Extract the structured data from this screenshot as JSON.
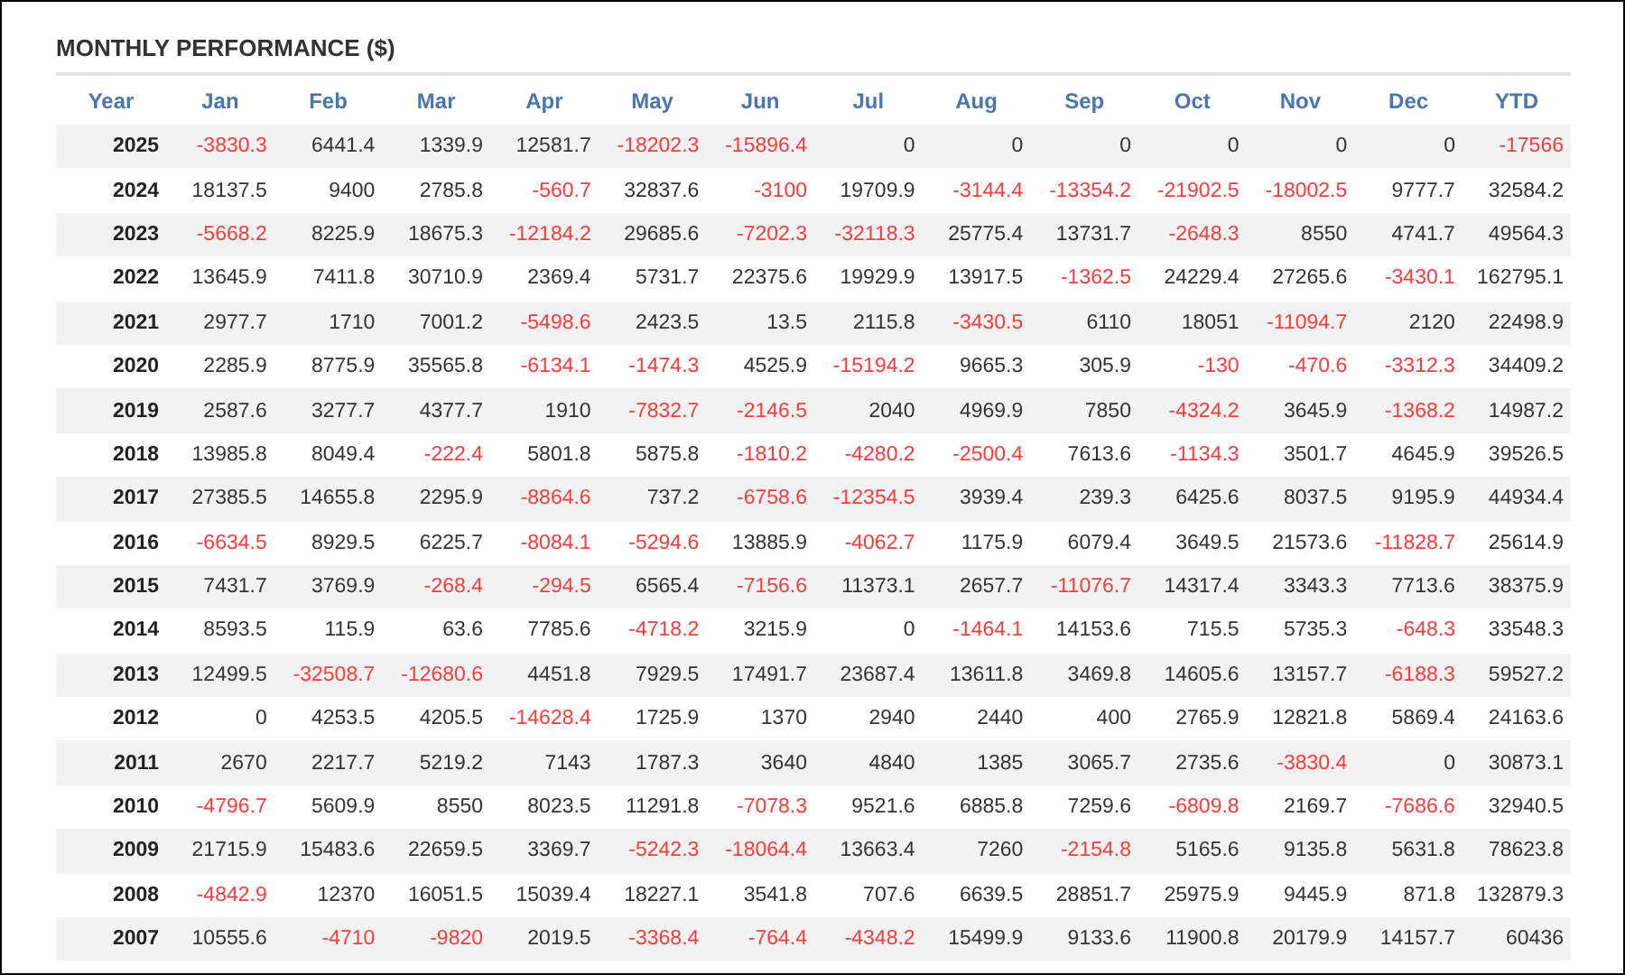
{
  "title": "MONTHLY PERFORMANCE ($)",
  "columns": [
    "Year",
    "Jan",
    "Feb",
    "Mar",
    "Apr",
    "May",
    "Jun",
    "Jul",
    "Aug",
    "Sep",
    "Oct",
    "Nov",
    "Dec",
    "YTD"
  ],
  "rows": [
    {
      "year": "2025",
      "cells": [
        {
          "text": "-3830.3",
          "loss": true
        },
        {
          "text": "6441.4",
          "loss": false
        },
        {
          "text": "1339.9",
          "loss": false
        },
        {
          "text": "12581.7",
          "loss": false
        },
        {
          "text": "-18202.3",
          "loss": true
        },
        {
          "text": "-15896.4",
          "loss": true
        },
        {
          "text": "0",
          "loss": false
        },
        {
          "text": "0",
          "loss": false
        },
        {
          "text": "0",
          "loss": false
        },
        {
          "text": "0",
          "loss": false
        },
        {
          "text": "0",
          "loss": false
        },
        {
          "text": "0",
          "loss": false
        },
        {
          "text": "-17566",
          "loss": true
        }
      ]
    },
    {
      "year": "2024",
      "cells": [
        {
          "text": "18137.5",
          "loss": false
        },
        {
          "text": "9400",
          "loss": false
        },
        {
          "text": "2785.8",
          "loss": false
        },
        {
          "text": "-560.7",
          "loss": true
        },
        {
          "text": "32837.6",
          "loss": false
        },
        {
          "text": "-3100",
          "loss": true
        },
        {
          "text": "19709.9",
          "loss": false
        },
        {
          "text": "-3144.4",
          "loss": true
        },
        {
          "text": "-13354.2",
          "loss": true
        },
        {
          "text": "-21902.5",
          "loss": true
        },
        {
          "text": "-18002.5",
          "loss": true
        },
        {
          "text": "9777.7",
          "loss": false
        },
        {
          "text": "32584.2",
          "loss": false
        }
      ]
    },
    {
      "year": "2023",
      "cells": [
        {
          "text": "-5668.2",
          "loss": true
        },
        {
          "text": "8225.9",
          "loss": false
        },
        {
          "text": "18675.3",
          "loss": false
        },
        {
          "text": "-12184.2",
          "loss": true
        },
        {
          "text": "29685.6",
          "loss": false
        },
        {
          "text": "-7202.3",
          "loss": true
        },
        {
          "text": "-32118.3",
          "loss": true
        },
        {
          "text": "25775.4",
          "loss": false
        },
        {
          "text": "13731.7",
          "loss": false
        },
        {
          "text": "-2648.3",
          "loss": true
        },
        {
          "text": "8550",
          "loss": false
        },
        {
          "text": "4741.7",
          "loss": false
        },
        {
          "text": "49564.3",
          "loss": false
        }
      ]
    },
    {
      "year": "2022",
      "cells": [
        {
          "text": "13645.9",
          "loss": false
        },
        {
          "text": "7411.8",
          "loss": false
        },
        {
          "text": "30710.9",
          "loss": false
        },
        {
          "text": "2369.4",
          "loss": false
        },
        {
          "text": "5731.7",
          "loss": false
        },
        {
          "text": "22375.6",
          "loss": false
        },
        {
          "text": "19929.9",
          "loss": false
        },
        {
          "text": "13917.5",
          "loss": false
        },
        {
          "text": "-1362.5",
          "loss": true
        },
        {
          "text": "24229.4",
          "loss": false
        },
        {
          "text": "27265.6",
          "loss": false
        },
        {
          "text": "-3430.1",
          "loss": true
        },
        {
          "text": "162795.1",
          "loss": false
        }
      ]
    },
    {
      "year": "2021",
      "cells": [
        {
          "text": "2977.7",
          "loss": false
        },
        {
          "text": "1710",
          "loss": false
        },
        {
          "text": "7001.2",
          "loss": false
        },
        {
          "text": "-5498.6",
          "loss": true
        },
        {
          "text": "2423.5",
          "loss": false
        },
        {
          "text": "13.5",
          "loss": false
        },
        {
          "text": "2115.8",
          "loss": false
        },
        {
          "text": "-3430.5",
          "loss": true
        },
        {
          "text": "6110",
          "loss": false
        },
        {
          "text": "18051",
          "loss": false
        },
        {
          "text": "-11094.7",
          "loss": true
        },
        {
          "text": "2120",
          "loss": false
        },
        {
          "text": "22498.9",
          "loss": false
        }
      ]
    },
    {
      "year": "2020",
      "cells": [
        {
          "text": "2285.9",
          "loss": false
        },
        {
          "text": "8775.9",
          "loss": false
        },
        {
          "text": "35565.8",
          "loss": false
        },
        {
          "text": "-6134.1",
          "loss": true
        },
        {
          "text": "-1474.3",
          "loss": true
        },
        {
          "text": "4525.9",
          "loss": false
        },
        {
          "text": "-15194.2",
          "loss": true
        },
        {
          "text": "9665.3",
          "loss": false
        },
        {
          "text": "305.9",
          "loss": false
        },
        {
          "text": "-130",
          "loss": true
        },
        {
          "text": "-470.6",
          "loss": true
        },
        {
          "text": "-3312.3",
          "loss": true
        },
        {
          "text": "34409.2",
          "loss": false
        }
      ]
    },
    {
      "year": "2019",
      "cells": [
        {
          "text": "2587.6",
          "loss": false
        },
        {
          "text": "3277.7",
          "loss": false
        },
        {
          "text": "4377.7",
          "loss": false
        },
        {
          "text": "1910",
          "loss": false
        },
        {
          "text": "-7832.7",
          "loss": true
        },
        {
          "text": "-2146.5",
          "loss": true
        },
        {
          "text": "2040",
          "loss": false
        },
        {
          "text": "4969.9",
          "loss": false
        },
        {
          "text": "7850",
          "loss": false
        },
        {
          "text": "-4324.2",
          "loss": true
        },
        {
          "text": "3645.9",
          "loss": false
        },
        {
          "text": "-1368.2",
          "loss": true
        },
        {
          "text": "14987.2",
          "loss": false
        }
      ]
    },
    {
      "year": "2018",
      "cells": [
        {
          "text": "13985.8",
          "loss": false
        },
        {
          "text": "8049.4",
          "loss": false
        },
        {
          "text": "-222.4",
          "loss": true
        },
        {
          "text": "5801.8",
          "loss": false
        },
        {
          "text": "5875.8",
          "loss": false
        },
        {
          "text": "-1810.2",
          "loss": true
        },
        {
          "text": "-4280.2",
          "loss": true
        },
        {
          "text": "-2500.4",
          "loss": true
        },
        {
          "text": "7613.6",
          "loss": false
        },
        {
          "text": "-1134.3",
          "loss": true
        },
        {
          "text": "3501.7",
          "loss": false
        },
        {
          "text": "4645.9",
          "loss": false
        },
        {
          "text": "39526.5",
          "loss": false
        }
      ]
    },
    {
      "year": "2017",
      "cells": [
        {
          "text": "27385.5",
          "loss": false
        },
        {
          "text": "14655.8",
          "loss": false
        },
        {
          "text": "2295.9",
          "loss": false
        },
        {
          "text": "-8864.6",
          "loss": true
        },
        {
          "text": "737.2",
          "loss": false
        },
        {
          "text": "-6758.6",
          "loss": true
        },
        {
          "text": "-12354.5",
          "loss": true
        },
        {
          "text": "3939.4",
          "loss": false
        },
        {
          "text": "239.3",
          "loss": false
        },
        {
          "text": "6425.6",
          "loss": false
        },
        {
          "text": "8037.5",
          "loss": false
        },
        {
          "text": "9195.9",
          "loss": false
        },
        {
          "text": "44934.4",
          "loss": false
        }
      ]
    },
    {
      "year": "2016",
      "cells": [
        {
          "text": "-6634.5",
          "loss": true
        },
        {
          "text": "8929.5",
          "loss": false
        },
        {
          "text": "6225.7",
          "loss": false
        },
        {
          "text": "-8084.1",
          "loss": true
        },
        {
          "text": "-5294.6",
          "loss": true
        },
        {
          "text": "13885.9",
          "loss": false
        },
        {
          "text": "-4062.7",
          "loss": true
        },
        {
          "text": "1175.9",
          "loss": false
        },
        {
          "text": "6079.4",
          "loss": false
        },
        {
          "text": "3649.5",
          "loss": false
        },
        {
          "text": "21573.6",
          "loss": false
        },
        {
          "text": "-11828.7",
          "loss": true
        },
        {
          "text": "25614.9",
          "loss": false
        }
      ]
    },
    {
      "year": "2015",
      "cells": [
        {
          "text": "7431.7",
          "loss": false
        },
        {
          "text": "3769.9",
          "loss": false
        },
        {
          "text": "-268.4",
          "loss": true
        },
        {
          "text": "-294.5",
          "loss": true
        },
        {
          "text": "6565.4",
          "loss": false
        },
        {
          "text": "-7156.6",
          "loss": true
        },
        {
          "text": "11373.1",
          "loss": false
        },
        {
          "text": "2657.7",
          "loss": false
        },
        {
          "text": "-11076.7",
          "loss": true
        },
        {
          "text": "14317.4",
          "loss": false
        },
        {
          "text": "3343.3",
          "loss": false
        },
        {
          "text": "7713.6",
          "loss": false
        },
        {
          "text": "38375.9",
          "loss": false
        }
      ]
    },
    {
      "year": "2014",
      "cells": [
        {
          "text": "8593.5",
          "loss": false
        },
        {
          "text": "115.9",
          "loss": false
        },
        {
          "text": "63.6",
          "loss": false
        },
        {
          "text": "7785.6",
          "loss": false
        },
        {
          "text": "-4718.2",
          "loss": true
        },
        {
          "text": "3215.9",
          "loss": false
        },
        {
          "text": "0",
          "loss": false
        },
        {
          "text": "-1464.1",
          "loss": true
        },
        {
          "text": "14153.6",
          "loss": false
        },
        {
          "text": "715.5",
          "loss": false
        },
        {
          "text": "5735.3",
          "loss": false
        },
        {
          "text": "-648.3",
          "loss": true
        },
        {
          "text": "33548.3",
          "loss": false
        }
      ]
    },
    {
      "year": "2013",
      "cells": [
        {
          "text": "12499.5",
          "loss": false
        },
        {
          "text": "-32508.7",
          "loss": true
        },
        {
          "text": "-12680.6",
          "loss": true
        },
        {
          "text": "4451.8",
          "loss": false
        },
        {
          "text": "7929.5",
          "loss": false
        },
        {
          "text": "17491.7",
          "loss": false
        },
        {
          "text": "23687.4",
          "loss": false
        },
        {
          "text": "13611.8",
          "loss": false
        },
        {
          "text": "3469.8",
          "loss": false
        },
        {
          "text": "14605.6",
          "loss": false
        },
        {
          "text": "13157.7",
          "loss": false
        },
        {
          "text": "-6188.3",
          "loss": true
        },
        {
          "text": "59527.2",
          "loss": false
        }
      ]
    },
    {
      "year": "2012",
      "cells": [
        {
          "text": "0",
          "loss": false
        },
        {
          "text": "4253.5",
          "loss": false
        },
        {
          "text": "4205.5",
          "loss": false
        },
        {
          "text": "-14628.4",
          "loss": true
        },
        {
          "text": "1725.9",
          "loss": false
        },
        {
          "text": "1370",
          "loss": false
        },
        {
          "text": "2940",
          "loss": false
        },
        {
          "text": "2440",
          "loss": false
        },
        {
          "text": "400",
          "loss": false
        },
        {
          "text": "2765.9",
          "loss": false
        },
        {
          "text": "12821.8",
          "loss": false
        },
        {
          "text": "5869.4",
          "loss": false
        },
        {
          "text": "24163.6",
          "loss": false
        }
      ]
    },
    {
      "year": "2011",
      "cells": [
        {
          "text": "2670",
          "loss": false
        },
        {
          "text": "2217.7",
          "loss": false
        },
        {
          "text": "5219.2",
          "loss": false
        },
        {
          "text": "7143",
          "loss": false
        },
        {
          "text": "1787.3",
          "loss": false
        },
        {
          "text": "3640",
          "loss": false
        },
        {
          "text": "4840",
          "loss": false
        },
        {
          "text": "1385",
          "loss": false
        },
        {
          "text": "3065.7",
          "loss": false
        },
        {
          "text": "2735.6",
          "loss": false
        },
        {
          "text": "-3830.4",
          "loss": true
        },
        {
          "text": "0",
          "loss": false
        },
        {
          "text": "30873.1",
          "loss": false
        }
      ]
    },
    {
      "year": "2010",
      "cells": [
        {
          "text": "-4796.7",
          "loss": true
        },
        {
          "text": "5609.9",
          "loss": false
        },
        {
          "text": "8550",
          "loss": false
        },
        {
          "text": "8023.5",
          "loss": false
        },
        {
          "text": "11291.8",
          "loss": false
        },
        {
          "text": "-7078.3",
          "loss": true
        },
        {
          "text": "9521.6",
          "loss": false
        },
        {
          "text": "6885.8",
          "loss": false
        },
        {
          "text": "7259.6",
          "loss": false
        },
        {
          "text": "-6809.8",
          "loss": true
        },
        {
          "text": "2169.7",
          "loss": false
        },
        {
          "text": "-7686.6",
          "loss": true
        },
        {
          "text": "32940.5",
          "loss": false
        }
      ]
    },
    {
      "year": "2009",
      "cells": [
        {
          "text": "21715.9",
          "loss": false
        },
        {
          "text": "15483.6",
          "loss": false
        },
        {
          "text": "22659.5",
          "loss": false
        },
        {
          "text": "3369.7",
          "loss": false
        },
        {
          "text": "-5242.3",
          "loss": true
        },
        {
          "text": "-18064.4",
          "loss": true
        },
        {
          "text": "13663.4",
          "loss": false
        },
        {
          "text": "7260",
          "loss": false
        },
        {
          "text": "-2154.8",
          "loss": true
        },
        {
          "text": "5165.6",
          "loss": false
        },
        {
          "text": "9135.8",
          "loss": false
        },
        {
          "text": "5631.8",
          "loss": false
        },
        {
          "text": "78623.8",
          "loss": false
        }
      ]
    },
    {
      "year": "2008",
      "cells": [
        {
          "text": "-4842.9",
          "loss": true
        },
        {
          "text": "12370",
          "loss": false
        },
        {
          "text": "16051.5",
          "loss": false
        },
        {
          "text": "15039.4",
          "loss": false
        },
        {
          "text": "18227.1",
          "loss": false
        },
        {
          "text": "3541.8",
          "loss": false
        },
        {
          "text": "707.6",
          "loss": false
        },
        {
          "text": "6639.5",
          "loss": false
        },
        {
          "text": "28851.7",
          "loss": false
        },
        {
          "text": "25975.9",
          "loss": false
        },
        {
          "text": "9445.9",
          "loss": false
        },
        {
          "text": "871.8",
          "loss": false
        },
        {
          "text": "132879.3",
          "loss": false
        }
      ]
    },
    {
      "year": "2007",
      "cells": [
        {
          "text": "10555.6",
          "loss": false
        },
        {
          "text": "-4710",
          "loss": true
        },
        {
          "text": "-9820",
          "loss": true
        },
        {
          "text": "2019.5",
          "loss": false
        },
        {
          "text": "-3368.4",
          "loss": true
        },
        {
          "text": "-764.4",
          "loss": true
        },
        {
          "text": "-4348.2",
          "loss": true
        },
        {
          "text": "15499.9",
          "loss": false
        },
        {
          "text": "9133.6",
          "loss": false
        },
        {
          "text": "11900.8",
          "loss": false
        },
        {
          "text": "20179.9",
          "loss": false
        },
        {
          "text": "14157.7",
          "loss": false
        },
        {
          "text": "60436",
          "loss": false
        }
      ]
    }
  ]
}
